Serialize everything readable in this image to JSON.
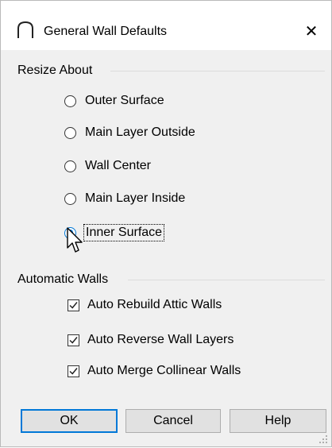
{
  "window": {
    "title": "General Wall Defaults",
    "close_glyph": "✕"
  },
  "resize_about": {
    "label": "Resize About",
    "options": [
      {
        "label": "Outer Surface",
        "selected": false
      },
      {
        "label": "Main Layer Outside",
        "selected": false
      },
      {
        "label": "Wall Center",
        "selected": false
      },
      {
        "label": "Main Layer Inside",
        "selected": false
      },
      {
        "label": "Inner Surface",
        "selected": true
      }
    ]
  },
  "automatic_walls": {
    "label": "Automatic Walls",
    "options": [
      {
        "label": "Auto Rebuild Attic Walls",
        "checked": true
      },
      {
        "label": "Auto Reverse Wall Layers",
        "checked": true
      },
      {
        "label": "Auto Merge Collinear Walls",
        "checked": true
      }
    ]
  },
  "buttons": {
    "ok": "OK",
    "cancel": "Cancel",
    "help": "Help"
  },
  "colors": {
    "accent": "#0078d7",
    "dialog_bg": "#f0f0f0"
  },
  "icons": {
    "app": "arch-wall-icon",
    "cursor": "mouse-pointer-icon"
  }
}
